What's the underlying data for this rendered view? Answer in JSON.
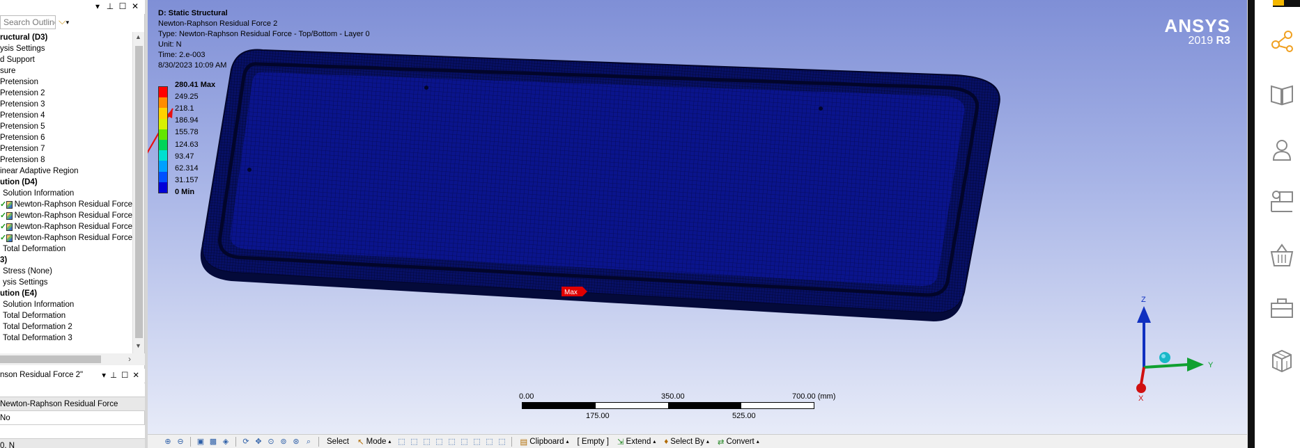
{
  "outline": {
    "search_placeholder": "Search Outline",
    "pin_controls": [
      "▾",
      "⊥",
      "☐",
      "✕"
    ],
    "tree": [
      {
        "label": "ructural (D3)",
        "bold": true,
        "check": false,
        "cube": false
      },
      {
        "label": "ysis Settings",
        "bold": false,
        "check": false,
        "cube": false
      },
      {
        "label": "d Support",
        "bold": false,
        "check": false,
        "cube": false
      },
      {
        "label": "sure",
        "bold": false,
        "check": false,
        "cube": false
      },
      {
        "label": "Pretension",
        "bold": false,
        "check": false,
        "cube": false
      },
      {
        "label": "Pretension 2",
        "bold": false,
        "check": false,
        "cube": false
      },
      {
        "label": "Pretension 3",
        "bold": false,
        "check": false,
        "cube": false
      },
      {
        "label": "Pretension 4",
        "bold": false,
        "check": false,
        "cube": false
      },
      {
        "label": "Pretension 5",
        "bold": false,
        "check": false,
        "cube": false
      },
      {
        "label": "Pretension 6",
        "bold": false,
        "check": false,
        "cube": false
      },
      {
        "label": "Pretension 7",
        "bold": false,
        "check": false,
        "cube": false
      },
      {
        "label": "Pretension 8",
        "bold": false,
        "check": false,
        "cube": false
      },
      {
        "label": "inear Adaptive Region",
        "bold": false,
        "check": false,
        "cube": false
      },
      {
        "label": "ution (D4)",
        "bold": true,
        "check": false,
        "cube": false
      },
      {
        "label": "Solution Information",
        "bold": false,
        "check": false,
        "cube": false
      },
      {
        "label": "Newton-Raphson Residual Force",
        "bold": false,
        "check": true,
        "cube": true
      },
      {
        "label": "Newton-Raphson Residual Force",
        "bold": false,
        "check": true,
        "cube": true
      },
      {
        "label": "Newton-Raphson Residual Force",
        "bold": false,
        "check": true,
        "cube": true
      },
      {
        "label": "Newton-Raphson Residual Force",
        "bold": false,
        "check": true,
        "cube": true
      },
      {
        "label": "Total Deformation",
        "bold": false,
        "check": false,
        "cube": false
      },
      {
        "label": "3)",
        "bold": true,
        "check": false,
        "cube": false
      },
      {
        "label": "Stress (None)",
        "bold": false,
        "check": false,
        "cube": false
      },
      {
        "label": "ysis Settings",
        "bold": false,
        "check": false,
        "cube": false
      },
      {
        "label": "ution (E4)",
        "bold": true,
        "check": false,
        "cube": false
      },
      {
        "label": "Solution Information",
        "bold": false,
        "check": false,
        "cube": false
      },
      {
        "label": "Total Deformation",
        "bold": false,
        "check": false,
        "cube": false
      },
      {
        "label": "Total Deformation 2",
        "bold": false,
        "check": false,
        "cube": false
      },
      {
        "label": "Total Deformation 3",
        "bold": false,
        "check": false,
        "cube": false
      }
    ]
  },
  "details": {
    "title": "nson Residual Force 2\"",
    "rows": [
      "",
      "Newton-Raphson Residual Force",
      "No",
      "",
      "0. N"
    ]
  },
  "viewport": {
    "title": "D: Static Structural",
    "lines": [
      "Newton-Raphson Residual Force 2",
      "Type: Newton-Raphson Residual Force - Top/Bottom - Layer 0",
      "Unit: N",
      "Time: 2.e-003",
      "8/30/2023 10:09 AM"
    ],
    "legend": {
      "labels": [
        "280.41 Max",
        "249.25",
        "218.1",
        "186.94",
        "155.78",
        "124.63",
        "93.47",
        "62.314",
        "31.157",
        "0 Min"
      ],
      "colors": [
        "#ff0000",
        "#ff8c00",
        "#ffd200",
        "#d8f000",
        "#63e600",
        "#00d45a",
        "#00e0d0",
        "#00a0ff",
        "#0050ff",
        "#0000d8"
      ]
    },
    "logo": {
      "brand": "ANSYS",
      "version_prefix": "2019 ",
      "version_suffix": "R3"
    },
    "max_label": "Max",
    "scale": {
      "top_labels": [
        "0.00",
        "350.00",
        "700.00 (mm)"
      ],
      "bottom_labels": [
        "175.00",
        "525.00"
      ]
    },
    "axes": {
      "z": "Z",
      "y": "Y",
      "x": "X"
    }
  },
  "toolbar": {
    "select": "Select",
    "mode": "Mode",
    "clipboard": "Clipboard",
    "empty": "[ Empty ]",
    "extend": "Extend",
    "select_by": "Select By",
    "convert": "Convert"
  },
  "colors": {
    "mesh": "#0a148c",
    "mesh_edge": "#050a3c",
    "accent": "#f5b800"
  }
}
